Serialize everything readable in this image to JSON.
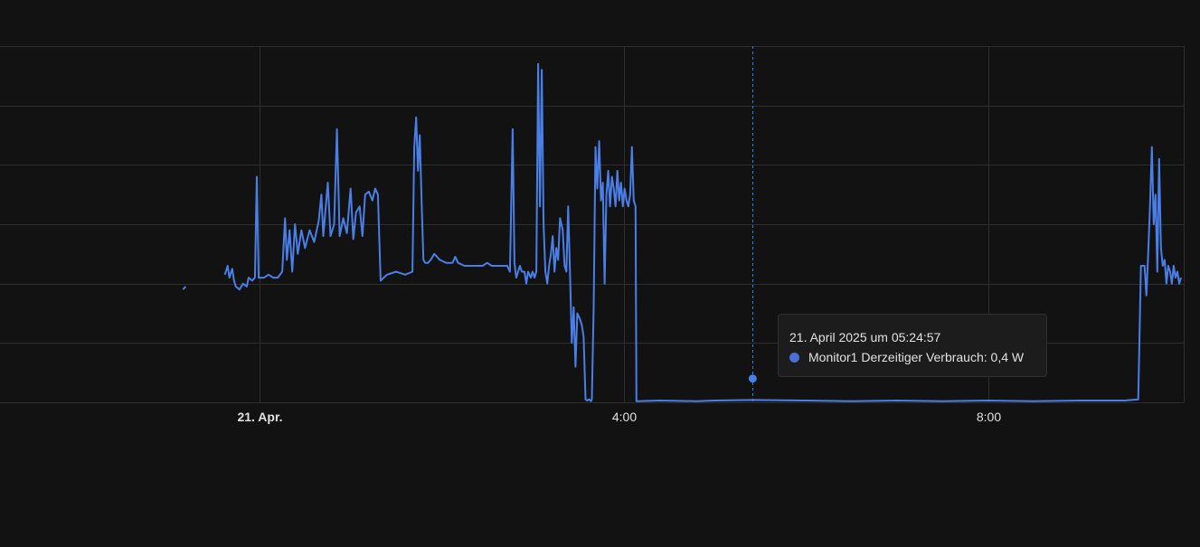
{
  "colors": {
    "background": "#121212",
    "grid": "#2e2e2e",
    "series": "#4a7fe8",
    "crosshair": "#1e88e5",
    "tick_text": "#e1e1e1"
  },
  "tooltip": {
    "time": "21. April 2025 um 05:24:57",
    "label": "Monitor1 Derzeitiger Verbrauch: 0,4 W"
  },
  "chart_data": {
    "type": "line",
    "title": "",
    "xlabel": "",
    "ylabel": "",
    "grid": true,
    "x_ticks": [
      {
        "label": "21. Apr.",
        "hour": 0,
        "bold": true
      },
      {
        "label": "4:00",
        "hour": 4,
        "bold": false
      },
      {
        "label": "8:00",
        "hour": 8,
        "bold": false
      }
    ],
    "y_gridlines": [
      0,
      1,
      2,
      3,
      4,
      5,
      6
    ],
    "xlim_hours": [
      -2.85,
      10.15
    ],
    "ylim": [
      0,
      6
    ],
    "crosshair_hour": 5.416,
    "highlight_point": {
      "hour": 5.416,
      "value": 0.4
    },
    "series": [
      {
        "name": "Monitor1 Derzeitiger Verbrauch",
        "points": [
          [
            -0.84,
            1.9
          ],
          [
            -0.81,
            1.95
          ],
          null,
          [
            -0.38,
            2.15
          ],
          [
            -0.35,
            2.3
          ],
          [
            -0.33,
            2.1
          ],
          [
            -0.3,
            2.25
          ],
          [
            -0.28,
            2.05
          ],
          [
            -0.26,
            1.95
          ],
          [
            -0.22,
            1.9
          ],
          [
            -0.18,
            2.0
          ],
          [
            -0.14,
            1.95
          ],
          [
            -0.12,
            2.1
          ],
          [
            -0.08,
            2.05
          ],
          [
            -0.05,
            2.1
          ],
          [
            -0.03,
            3.8
          ],
          [
            -0.01,
            2.1
          ],
          [
            0.05,
            2.1
          ],
          [
            0.1,
            2.15
          ],
          [
            0.15,
            2.1
          ],
          [
            0.2,
            2.1
          ],
          [
            0.25,
            2.2
          ],
          [
            0.28,
            3.1
          ],
          [
            0.3,
            2.4
          ],
          [
            0.33,
            2.9
          ],
          [
            0.36,
            2.2
          ],
          [
            0.39,
            3.0
          ],
          [
            0.42,
            2.5
          ],
          [
            0.46,
            2.9
          ],
          [
            0.5,
            2.6
          ],
          [
            0.55,
            2.9
          ],
          [
            0.6,
            2.7
          ],
          [
            0.65,
            3.05
          ],
          [
            0.68,
            3.5
          ],
          [
            0.7,
            2.8
          ],
          [
            0.75,
            3.7
          ],
          [
            0.78,
            2.8
          ],
          [
            0.82,
            3.0
          ],
          [
            0.85,
            4.6
          ],
          [
            0.88,
            2.8
          ],
          [
            0.92,
            3.1
          ],
          [
            0.96,
            2.85
          ],
          [
            1.0,
            3.6
          ],
          [
            1.03,
            2.75
          ],
          [
            1.06,
            3.2
          ],
          [
            1.1,
            3.3
          ],
          [
            1.13,
            2.8
          ],
          [
            1.16,
            3.5
          ],
          [
            1.2,
            3.55
          ],
          [
            1.24,
            3.4
          ],
          [
            1.27,
            3.6
          ],
          [
            1.3,
            3.5
          ],
          [
            1.33,
            2.05
          ],
          [
            1.4,
            2.15
          ],
          [
            1.5,
            2.2
          ],
          [
            1.6,
            2.15
          ],
          [
            1.68,
            2.2
          ],
          [
            1.7,
            4.3
          ],
          [
            1.72,
            4.8
          ],
          [
            1.74,
            3.9
          ],
          [
            1.76,
            4.5
          ],
          [
            1.78,
            3.4
          ],
          [
            1.8,
            2.4
          ],
          [
            1.82,
            2.35
          ],
          [
            1.85,
            2.35
          ],
          [
            1.88,
            2.4
          ],
          [
            1.92,
            2.5
          ],
          [
            1.98,
            2.4
          ],
          [
            2.05,
            2.35
          ],
          [
            2.12,
            2.35
          ],
          [
            2.15,
            2.45
          ],
          [
            2.18,
            2.35
          ],
          [
            2.25,
            2.3
          ],
          [
            2.35,
            2.3
          ],
          [
            2.45,
            2.3
          ],
          [
            2.5,
            2.35
          ],
          [
            2.55,
            2.3
          ],
          [
            2.65,
            2.3
          ],
          [
            2.72,
            2.3
          ],
          [
            2.75,
            2.2
          ],
          [
            2.78,
            4.6
          ],
          [
            2.8,
            2.35
          ],
          [
            2.82,
            2.1
          ],
          [
            2.84,
            2.2
          ],
          [
            2.86,
            2.3
          ],
          [
            2.88,
            2.2
          ],
          [
            2.91,
            2.2
          ],
          [
            2.93,
            2.0
          ],
          [
            2.95,
            2.2
          ],
          [
            2.98,
            2.1
          ],
          [
            3.0,
            2.2
          ],
          [
            3.02,
            2.1
          ],
          [
            3.04,
            2.2
          ],
          [
            3.06,
            5.7
          ],
          [
            3.08,
            3.3
          ],
          [
            3.1,
            5.6
          ],
          [
            3.12,
            3.0
          ],
          [
            3.14,
            2.2
          ],
          [
            3.16,
            2.0
          ],
          [
            3.18,
            2.3
          ],
          [
            3.2,
            2.5
          ],
          [
            3.22,
            2.8
          ],
          [
            3.24,
            2.2
          ],
          [
            3.26,
            2.6
          ],
          [
            3.28,
            2.4
          ],
          [
            3.3,
            3.1
          ],
          [
            3.33,
            2.9
          ],
          [
            3.35,
            2.3
          ],
          [
            3.37,
            2.2
          ],
          [
            3.39,
            3.3
          ],
          [
            3.41,
            2.2
          ],
          [
            3.43,
            1.0
          ],
          [
            3.45,
            1.6
          ],
          [
            3.47,
            0.6
          ],
          [
            3.49,
            1.5
          ],
          [
            3.52,
            1.4
          ],
          [
            3.54,
            1.3
          ],
          [
            3.56,
            1.1
          ],
          [
            3.58,
            0.05
          ],
          [
            3.6,
            0.03
          ],
          [
            3.62,
            0.05
          ],
          [
            3.64,
            0.02
          ],
          [
            3.65,
            0.05
          ],
          [
            3.67,
            1.6
          ],
          [
            3.69,
            4.3
          ],
          [
            3.71,
            3.6
          ],
          [
            3.73,
            4.4
          ],
          [
            3.75,
            3.4
          ],
          [
            3.77,
            3.7
          ],
          [
            3.79,
            2.0
          ],
          [
            3.81,
            3.5
          ],
          [
            3.83,
            3.9
          ],
          [
            3.85,
            3.3
          ],
          [
            3.87,
            3.8
          ],
          [
            3.89,
            3.6
          ],
          [
            3.91,
            3.3
          ],
          [
            3.93,
            3.9
          ],
          [
            3.95,
            3.4
          ],
          [
            3.97,
            3.7
          ],
          [
            3.99,
            3.3
          ],
          [
            4.01,
            3.6
          ],
          [
            4.03,
            3.4
          ],
          [
            4.05,
            3.3
          ],
          [
            4.07,
            3.5
          ],
          [
            4.09,
            4.3
          ],
          [
            4.11,
            3.4
          ],
          [
            4.13,
            3.3
          ],
          [
            4.14,
            0.02
          ],
          [
            4.4,
            0.03
          ],
          [
            4.8,
            0.02
          ],
          [
            5.0,
            0.03
          ],
          [
            5.416,
            0.04
          ],
          [
            6.0,
            0.03
          ],
          [
            6.5,
            0.02
          ],
          [
            7.0,
            0.03
          ],
          [
            7.5,
            0.02
          ],
          [
            8.0,
            0.03
          ],
          [
            8.5,
            0.02
          ],
          [
            9.0,
            0.03
          ],
          [
            9.5,
            0.03
          ],
          [
            9.65,
            0.05
          ],
          [
            9.68,
            2.3
          ],
          [
            9.72,
            2.3
          ],
          [
            9.74,
            1.8
          ],
          [
            9.76,
            2.5
          ],
          [
            9.78,
            3.3
          ],
          [
            9.8,
            4.3
          ],
          [
            9.82,
            3.0
          ],
          [
            9.84,
            3.5
          ],
          [
            9.86,
            2.2
          ],
          [
            9.88,
            4.1
          ],
          [
            9.9,
            2.6
          ],
          [
            9.92,
            2.3
          ],
          [
            9.94,
            2.4
          ],
          [
            9.96,
            2.0
          ],
          [
            9.98,
            2.3
          ],
          [
            10.0,
            2.2
          ],
          [
            10.02,
            2.0
          ],
          [
            10.04,
            2.3
          ],
          [
            10.06,
            2.1
          ],
          [
            10.08,
            2.2
          ],
          [
            10.1,
            2.0
          ],
          [
            10.12,
            2.1
          ]
        ]
      }
    ]
  }
}
